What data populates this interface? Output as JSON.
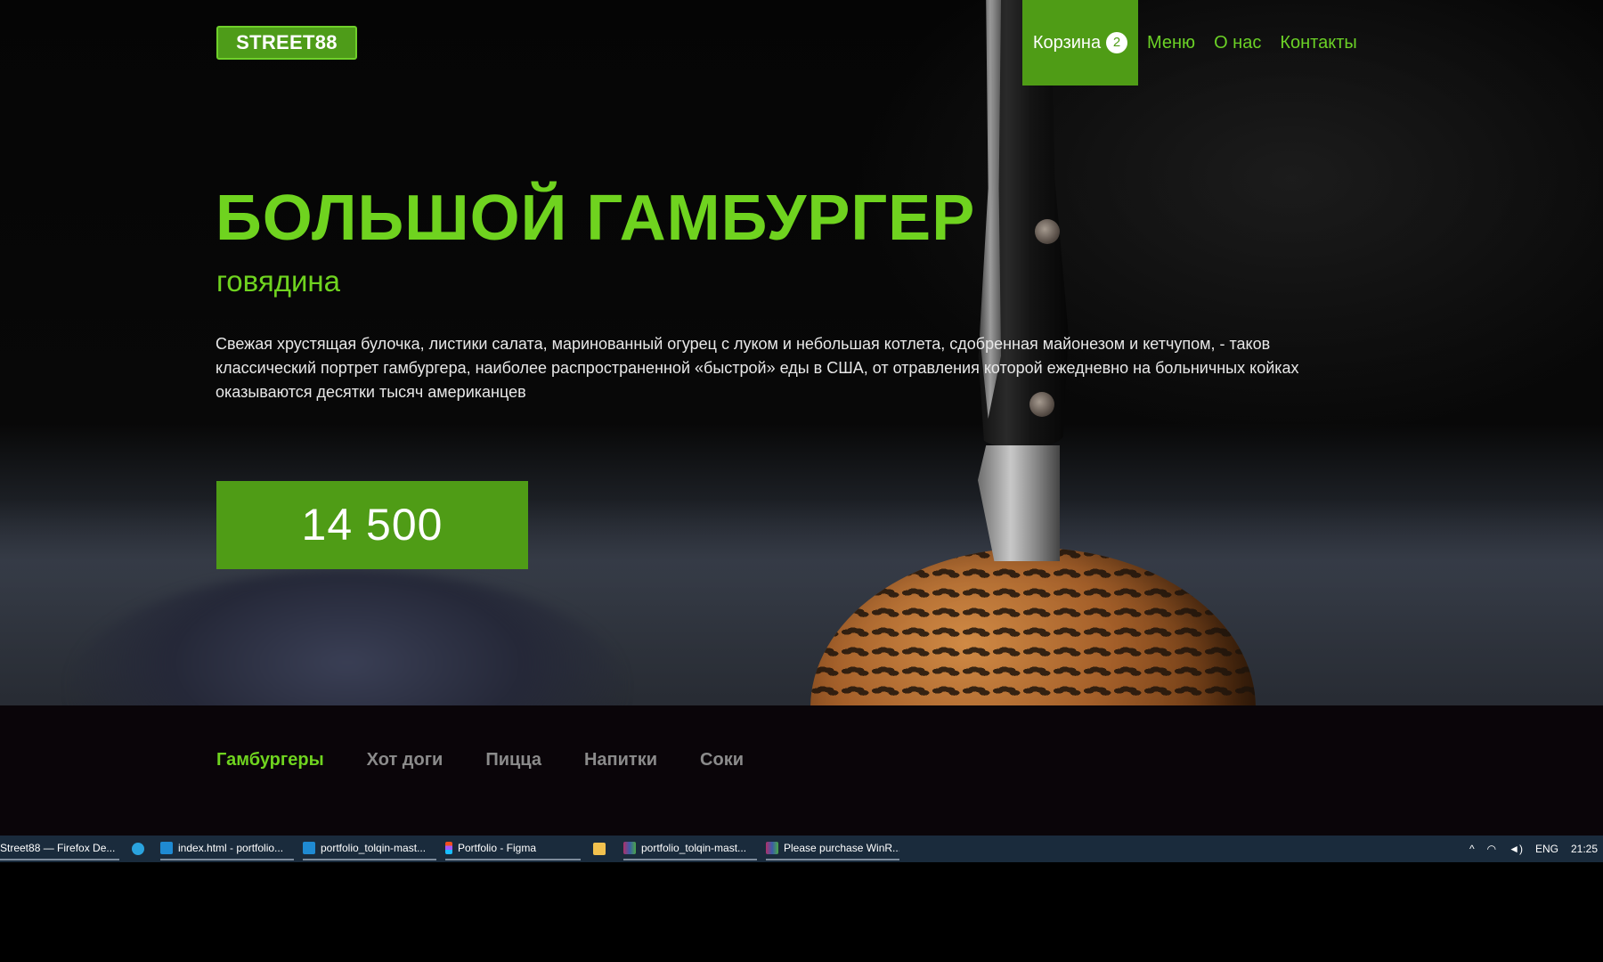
{
  "brand": {
    "logo": "STREET88"
  },
  "nav": {
    "cart_label": "Корзина",
    "cart_count": "2",
    "links": [
      "Меню",
      "О нас",
      "Контакты"
    ]
  },
  "hero": {
    "title": "БОЛЬШОЙ ГАМБУРГЕР",
    "subtitle": "говядина",
    "description": "Свежая хрустящая булочка, листики салата, маринованный огурец с луком и небольшая котлета, сдобренная майонезом и кетчупом, - таков классический портрет гамбургера, наиболее распространенной «быстрой» еды в США, от отравления которой ежедневно на больничных койках оказываются десятки тысяч американцев",
    "price": "14 500"
  },
  "categories": [
    {
      "label": "Гамбургеры",
      "active": true
    },
    {
      "label": "Хот доги",
      "active": false
    },
    {
      "label": "Пицца",
      "active": false
    },
    {
      "label": "Напитки",
      "active": false
    },
    {
      "label": "Соки",
      "active": false
    }
  ],
  "taskbar": {
    "items": [
      {
        "label": "Street88 — Firefox De...",
        "icon": "firefox-icon"
      },
      {
        "label": "",
        "icon": "telegram-icon"
      },
      {
        "label": "index.html - portfolio...",
        "icon": "vscode-icon"
      },
      {
        "label": "portfolio_tolqin-mast...",
        "icon": "vscode-icon"
      },
      {
        "label": "Portfolio - Figma",
        "icon": "figma-icon"
      },
      {
        "label": "",
        "icon": "folder-icon"
      },
      {
        "label": "portfolio_tolqin-mast...",
        "icon": "winrar-icon"
      },
      {
        "label": "Please purchase WinR...",
        "icon": "winrar-icon"
      }
    ],
    "tray": {
      "language": "ENG",
      "time": "21:25"
    }
  },
  "colors": {
    "accent": "#6fd31f",
    "accent_dark": "#4f9c16",
    "taskbar": "#1a2b3c"
  }
}
